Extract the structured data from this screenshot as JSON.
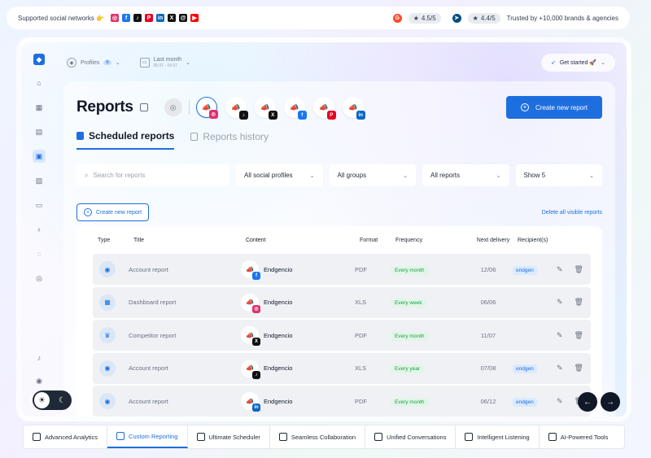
{
  "topbar": {
    "supported_label": "Supported social networks 👉",
    "networks": [
      {
        "icon": "instagram-icon",
        "glyph": "◎",
        "color": "#e1306c"
      },
      {
        "icon": "facebook-icon",
        "glyph": "f",
        "color": "#1877f2"
      },
      {
        "icon": "tiktok-icon",
        "glyph": "♪",
        "color": "#111111"
      },
      {
        "icon": "pinterest-icon",
        "glyph": "P",
        "color": "#e60023"
      },
      {
        "icon": "linkedin-icon",
        "glyph": "in",
        "color": "#0a66c2"
      },
      {
        "icon": "x-icon",
        "glyph": "X",
        "color": "#111111"
      },
      {
        "icon": "threads-icon",
        "glyph": "@",
        "color": "#111111"
      },
      {
        "icon": "youtube-icon",
        "glyph": "▶",
        "color": "#ff0000"
      }
    ],
    "g2_rating": "4.5/5",
    "capterra_rating": "4.4/5",
    "trusted_text": "Trusted by +10,000 brands & agencies"
  },
  "header": {
    "profiles_label": "Profiles",
    "profiles_count": "6",
    "period_label": "Last month",
    "period_range": "05.07 - 04.07",
    "get_started": "Get started 🚀"
  },
  "page": {
    "title": "Reports",
    "create_button": "Create new report",
    "profiles": [
      {
        "network": "instagram",
        "glyph": "◎",
        "color": "#e1306c",
        "selected": true
      },
      {
        "network": "tiktok",
        "glyph": "♪",
        "color": "#111111",
        "selected": false
      },
      {
        "network": "x",
        "glyph": "X",
        "color": "#111111",
        "selected": false
      },
      {
        "network": "facebook",
        "glyph": "f",
        "color": "#1877f2",
        "selected": false
      },
      {
        "network": "pinterest",
        "glyph": "P",
        "color": "#e60023",
        "selected": false
      },
      {
        "network": "linkedin",
        "glyph": "in",
        "color": "#0a66c2",
        "selected": false
      }
    ]
  },
  "tabs": {
    "scheduled": "Scheduled reports",
    "history": "Reports history"
  },
  "filters": {
    "search_placeholder": "Search for reports",
    "profiles": "All social profiles",
    "groups": "All groups",
    "reports": "All reports",
    "show": "Show 5"
  },
  "actions": {
    "create_small": "Create new report",
    "delete_all": "Delete all visible reports"
  },
  "table": {
    "headers": [
      "Type",
      "Title",
      "Content",
      "Format",
      "Frequency",
      "Next delivery",
      "Recipient(s)"
    ],
    "rows": [
      {
        "type_icon": "account-icon",
        "type_glyph": "◉",
        "title": "Account report",
        "content": "Endgencio",
        "network_glyph": "f",
        "network_color": "#1877f2",
        "format": "PDF",
        "frequency": "Every month",
        "next": "12/06",
        "recipient": "endgen"
      },
      {
        "type_icon": "dashboard-icon",
        "type_glyph": "▦",
        "title": "Dashboard report",
        "content": "Endgencio",
        "network_glyph": "◎",
        "network_color": "#e1306c",
        "format": "XLS",
        "frequency": "Every week",
        "next": "06/06",
        "recipient": ""
      },
      {
        "type_icon": "competitor-icon",
        "type_glyph": "♛",
        "title": "Competitor report",
        "content": "Endgencio",
        "network_glyph": "X",
        "network_color": "#111111",
        "format": "PDF",
        "frequency": "Every month",
        "next": "11/07",
        "recipient": ""
      },
      {
        "type_icon": "account-icon",
        "type_glyph": "◉",
        "title": "Account report",
        "content": "Endgencio",
        "network_glyph": "♪",
        "network_color": "#111111",
        "format": "XLS",
        "frequency": "Every year",
        "next": "07/08",
        "recipient": "endgen"
      },
      {
        "type_icon": "account-icon",
        "type_glyph": "◉",
        "title": "Account report",
        "content": "Endgencio",
        "network_glyph": "in",
        "network_color": "#0a66c2",
        "format": "PDF",
        "frequency": "Every month",
        "next": "06/12",
        "recipient": "endgen"
      }
    ]
  },
  "bottom_tabs": [
    {
      "label": "Advanced Analytics",
      "icon": "analytics-icon",
      "active": false
    },
    {
      "label": "Custom Reporting",
      "icon": "reporting-icon",
      "active": true
    },
    {
      "label": "Ultimate Scheduler",
      "icon": "scheduler-icon",
      "active": false
    },
    {
      "label": "Seamless Collaboration",
      "icon": "collaboration-icon",
      "active": false
    },
    {
      "label": "Unified Conversations",
      "icon": "conversations-icon",
      "active": false
    },
    {
      "label": "Intelligent Listening",
      "icon": "listening-icon",
      "active": false
    },
    {
      "label": "AI-Powered Tools",
      "icon": "ai-tools-icon",
      "active": false
    }
  ]
}
